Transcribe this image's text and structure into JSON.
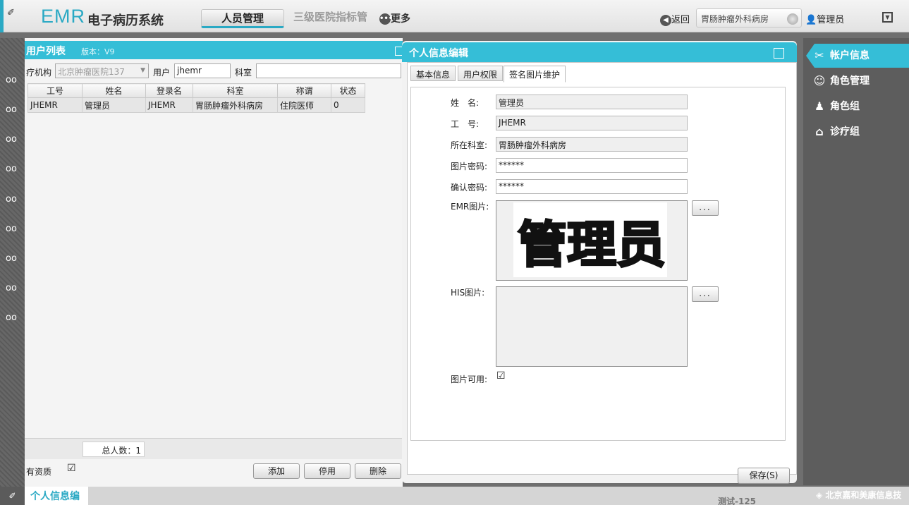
{
  "header": {
    "brand_emr": "EMR",
    "brand_cn": "电子病历系统",
    "nav_active": "人员管理",
    "nav_quality": "三级医院指标管",
    "nav_more": "更多",
    "back_label": "返回",
    "department": "胃肠肿瘤外科病房",
    "user": "管理员"
  },
  "user_list": {
    "title": "用户列表",
    "version": "版本：V9",
    "filters": {
      "org_label": "疗机构",
      "org_value": "北京肿瘤医院137",
      "user_label": "用户",
      "user_value": "jhemr",
      "dept_label": "科室",
      "dept_value": ""
    },
    "columns": [
      "工号",
      "姓名",
      "登录名",
      "科室",
      "称谓",
      "状态"
    ],
    "rows": [
      [
        "JHEMR",
        "管理员",
        "JHEMR",
        "胃肠肿瘤外科病房",
        "住院医师",
        "0"
      ]
    ],
    "total_label": "总人数：1",
    "qualification_label": "有资质",
    "qualification_checked": true,
    "buttons": {
      "add": "添加",
      "disable": "停用",
      "delete": "删除"
    }
  },
  "editor": {
    "title": "个人信息编辑",
    "tabs": [
      "基本信息",
      "用户权限",
      "签名图片维护"
    ],
    "active_tab": 2,
    "fields": {
      "name_label": "姓　名:",
      "name_value": "管理员",
      "id_label": "工　号:",
      "id_value": "JHEMR",
      "dept_label": "所在科室:",
      "dept_value": "胃肠肿瘤外科病房",
      "pwd_label": "图片密码:",
      "pwd_value": "******",
      "confirm_label": "确认密码:",
      "confirm_value": "******",
      "emr_img_label": "EMR图片:",
      "his_img_label": "HIS图片:",
      "dots_label": "...",
      "avail_label": "图片可用:",
      "avail_checked": true
    },
    "signature_text": "管理员",
    "save_label": "保存(S)"
  },
  "right_menu": {
    "items": [
      {
        "label": "帐户信息",
        "icon": "wrench-icon",
        "active": true
      },
      {
        "label": "角色管理",
        "icon": "role-icon",
        "active": false
      },
      {
        "label": "角色组",
        "icon": "group-icon",
        "active": false
      },
      {
        "label": "诊疗组",
        "icon": "medical-group-icon",
        "active": false
      }
    ]
  },
  "bottom_bar": {
    "tab_label": "个人信息编",
    "test_text": "测试-125",
    "company": "北京嘉和美康信息技"
  },
  "colors": {
    "accent": "#35bed7",
    "brand": "#2aa9c4",
    "rail": "#5d5d5d"
  }
}
